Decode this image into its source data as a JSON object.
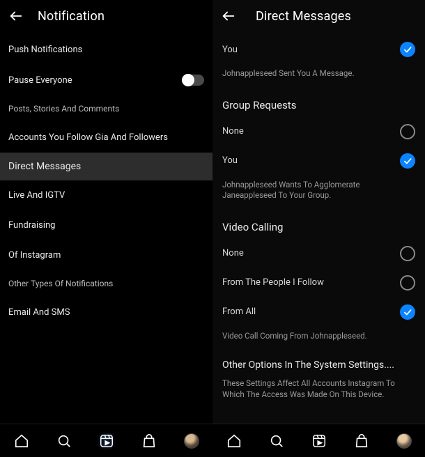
{
  "left": {
    "title": "Notification",
    "items": [
      {
        "label": "Push Notifications"
      },
      {
        "label": "Pause Everyone",
        "toggle": true
      },
      {
        "label": "Posts, Stories And Comments",
        "sub": true
      },
      {
        "label": "Accounts You Follow Gia And Followers"
      },
      {
        "label": "Direct Messages",
        "selected": true
      },
      {
        "label": "Live And IGTV"
      },
      {
        "label": "Fundraising"
      },
      {
        "label": "Of Instagram"
      },
      {
        "label": "Other Types Of Notifications",
        "sub": true
      },
      {
        "label": "Email And SMS"
      }
    ]
  },
  "right": {
    "title": "Direct Messages",
    "sections": [
      {
        "options": [
          {
            "label": "You",
            "checked": true
          }
        ],
        "helper": "Johnappleseed Sent You A Message."
      },
      {
        "title": "Group Requests",
        "options": [
          {
            "label": "None",
            "checked": false
          },
          {
            "label": "You",
            "checked": true
          }
        ],
        "helper": "Johnappleseed Wants To Agglomerate Janeappleseed To Your Group."
      },
      {
        "title": "Video Calling",
        "options": [
          {
            "label": "None",
            "checked": false
          },
          {
            "label": "From The People I Follow",
            "checked": false
          },
          {
            "label": "From All",
            "checked": true
          }
        ],
        "helper": "Video Call Coming From Johnappleseed."
      }
    ],
    "other_title": "Other Options In The System Settings....",
    "other_helper": "These Settings Affect All Accounts Instagram To Which The Access Was Made On This Device."
  },
  "chart_data": null
}
